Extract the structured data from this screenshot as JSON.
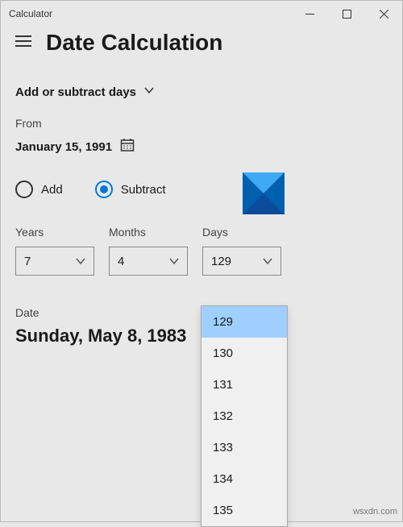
{
  "titlebar": {
    "title": "Calculator"
  },
  "page": {
    "title": "Date Calculation"
  },
  "mode": {
    "label": "Add or subtract days"
  },
  "from": {
    "label": "From",
    "date": "January 15, 1991"
  },
  "radios": {
    "add": "Add",
    "subtract": "Subtract"
  },
  "pickers": {
    "years": {
      "label": "Years",
      "value": "7"
    },
    "months": {
      "label": "Months",
      "value": "4"
    },
    "days": {
      "label": "Days",
      "value": "129"
    }
  },
  "dropdown": {
    "items": [
      "129",
      "130",
      "131",
      "132",
      "133",
      "134",
      "135"
    ],
    "selected": "129"
  },
  "result": {
    "label": "Date",
    "value": "Sunday, May 8, 1983"
  },
  "watermark": "wsxdn.com"
}
